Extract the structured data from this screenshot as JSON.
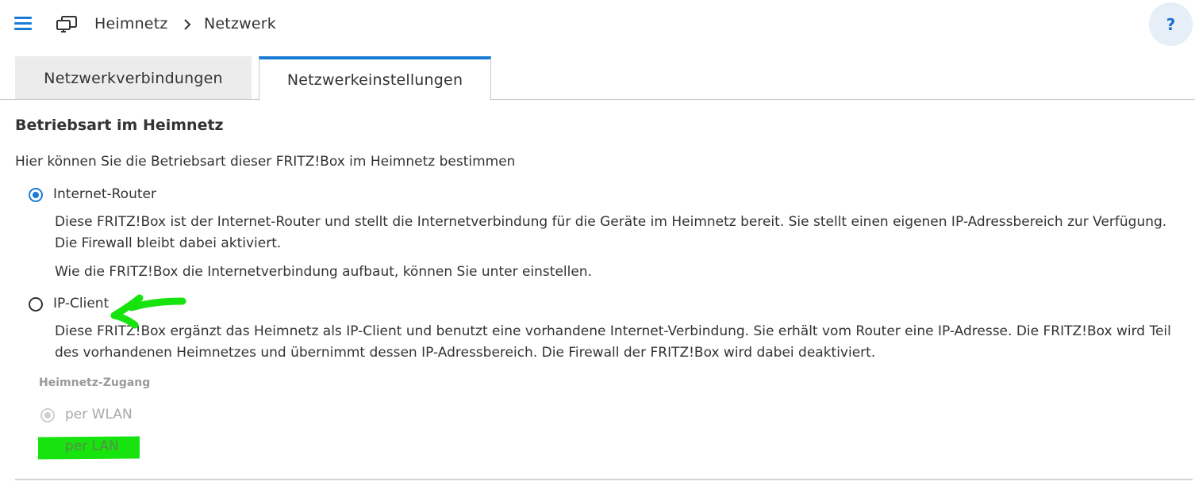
{
  "header": {
    "breadcrumb_home": "Heimnetz",
    "breadcrumb_current": "Netzwerk",
    "help_label": "?"
  },
  "tabs": [
    {
      "label": "Netzwerkverbindungen",
      "active": false
    },
    {
      "label": "Netzwerkeinstellungen",
      "active": true
    }
  ],
  "section": {
    "title": "Betriebsart im Heimnetz",
    "intro": "Hier können Sie die Betriebsart dieser FRITZ!Box im Heimnetz bestimmen"
  },
  "options": {
    "router": {
      "label": "Internet-Router",
      "checked": true,
      "desc1": "Diese FRITZ!Box ist der Internet-Router und stellt die Internetverbindung für die Geräte im Heimnetz bereit. Sie stellt einen eigenen IP-Adressbereich zur Verfügung. Die Firewall bleibt dabei aktiviert.",
      "desc2": "Wie die FRITZ!Box die Internetverbindung aufbaut, können Sie unter einstellen."
    },
    "ipclient": {
      "label": "IP-Client",
      "checked": false,
      "desc": "Diese FRITZ!Box ergänzt das Heimnetz als IP-Client und benutzt eine vorhandene Internet-Verbindung. Sie erhält vom Router eine IP-Adresse. Die FRITZ!Box wird Teil des vorhandenen Heimnetzes und übernimmt dessen IP-Adressbereich. Die Firewall der FRITZ!Box wird dabei deaktiviert."
    }
  },
  "access": {
    "title": "Heimnetz-Zugang",
    "wlan_label": "per WLAN",
    "lan_label": "per LAN"
  },
  "colors": {
    "accent": "#1a7bd6",
    "highlight": "#17e30e",
    "annotation_arrow": "#17e30e"
  },
  "icons": {
    "menu": "menu-icon",
    "network": "network-monitor-icon",
    "breadcrumb_separator": "chevron-right-icon",
    "annotation": "arrow-annotation-icon"
  }
}
